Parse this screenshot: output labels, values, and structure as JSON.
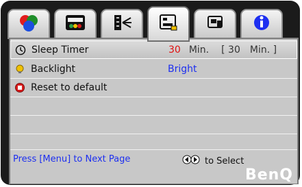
{
  "tabs": [
    {
      "icon": "color-circles-icon"
    },
    {
      "icon": "display-settings-icon"
    },
    {
      "icon": "image-tuning-icon"
    },
    {
      "icon": "system-settings-icon"
    },
    {
      "icon": "projector-icon"
    },
    {
      "icon": "info-icon"
    }
  ],
  "active_tab_index": 3,
  "menu": {
    "rows": [
      {
        "label": "Sleep Timer",
        "icon": "clock-icon",
        "value": "30",
        "unit": "Min.",
        "bracket_value": "[ 30",
        "bracket_unit": "Min. ]"
      },
      {
        "label": "Backlight",
        "icon": "bulb-icon",
        "value": "Bright"
      },
      {
        "label": "Reset to default",
        "icon": "reset-icon"
      }
    ]
  },
  "footer": {
    "hint": "Press [Menu] to Next Page",
    "select_hint": "to Select",
    "logo": "BenQ"
  },
  "colors": {
    "value_red": "#e01010",
    "value_blue": "#1d2ff0"
  }
}
